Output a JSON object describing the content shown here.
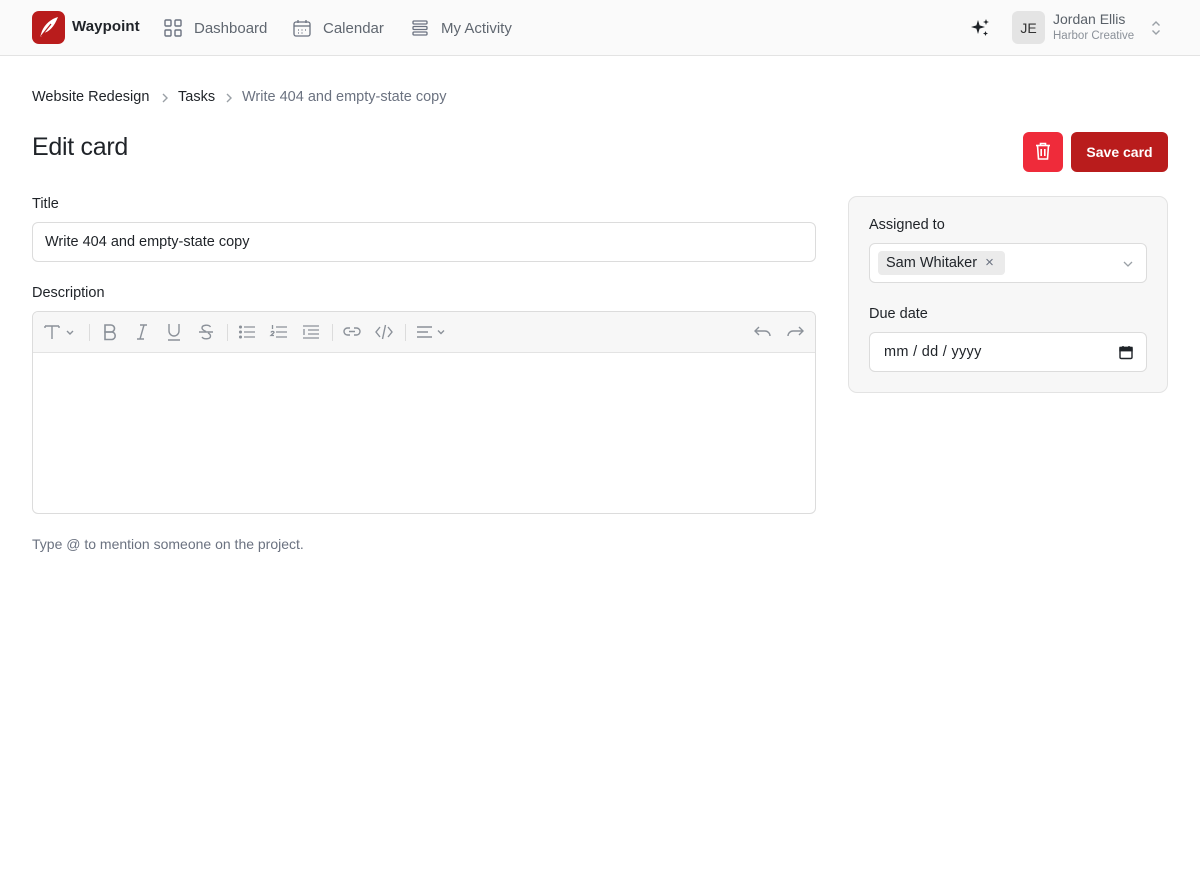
{
  "app": {
    "name": "Waypoint",
    "brand_color": "#b91c1c",
    "logo_icon": "feather-icon"
  },
  "nav": {
    "items": [
      {
        "label": "Dashboard",
        "icon": "grid-icon"
      },
      {
        "label": "Calendar",
        "icon": "calendar-icon"
      },
      {
        "label": "My Activity",
        "icon": "list-stack-icon"
      }
    ]
  },
  "user": {
    "initials": "JE",
    "name": "Jordan Ellis",
    "org": "Harbor Creative"
  },
  "breadcrumb": [
    "Website Redesign",
    "Tasks",
    "Write 404 and empty-state copy"
  ],
  "page": {
    "title": "Edit card",
    "save_label": "Save card",
    "delete_color": "#ef2b3a"
  },
  "form": {
    "title_label": "Title",
    "title_value": "Write 404 and empty-state copy",
    "description_label": "Description",
    "description_value": "",
    "hint": "Type @ to mention someone on the project."
  },
  "editor_toolbar": [
    "text-style-icon",
    "bold-icon",
    "italic-icon",
    "underline-icon",
    "strikethrough-icon",
    "bullet-list-icon",
    "numbered-list-icon",
    "indent-icon",
    "link-icon",
    "code-icon",
    "align-icon",
    "undo-icon",
    "redo-icon"
  ],
  "side": {
    "assigned_label": "Assigned to",
    "assignee": "Sam Whitaker",
    "due_label": "Due date",
    "due_placeholder": "mm / dd / yyyy"
  }
}
